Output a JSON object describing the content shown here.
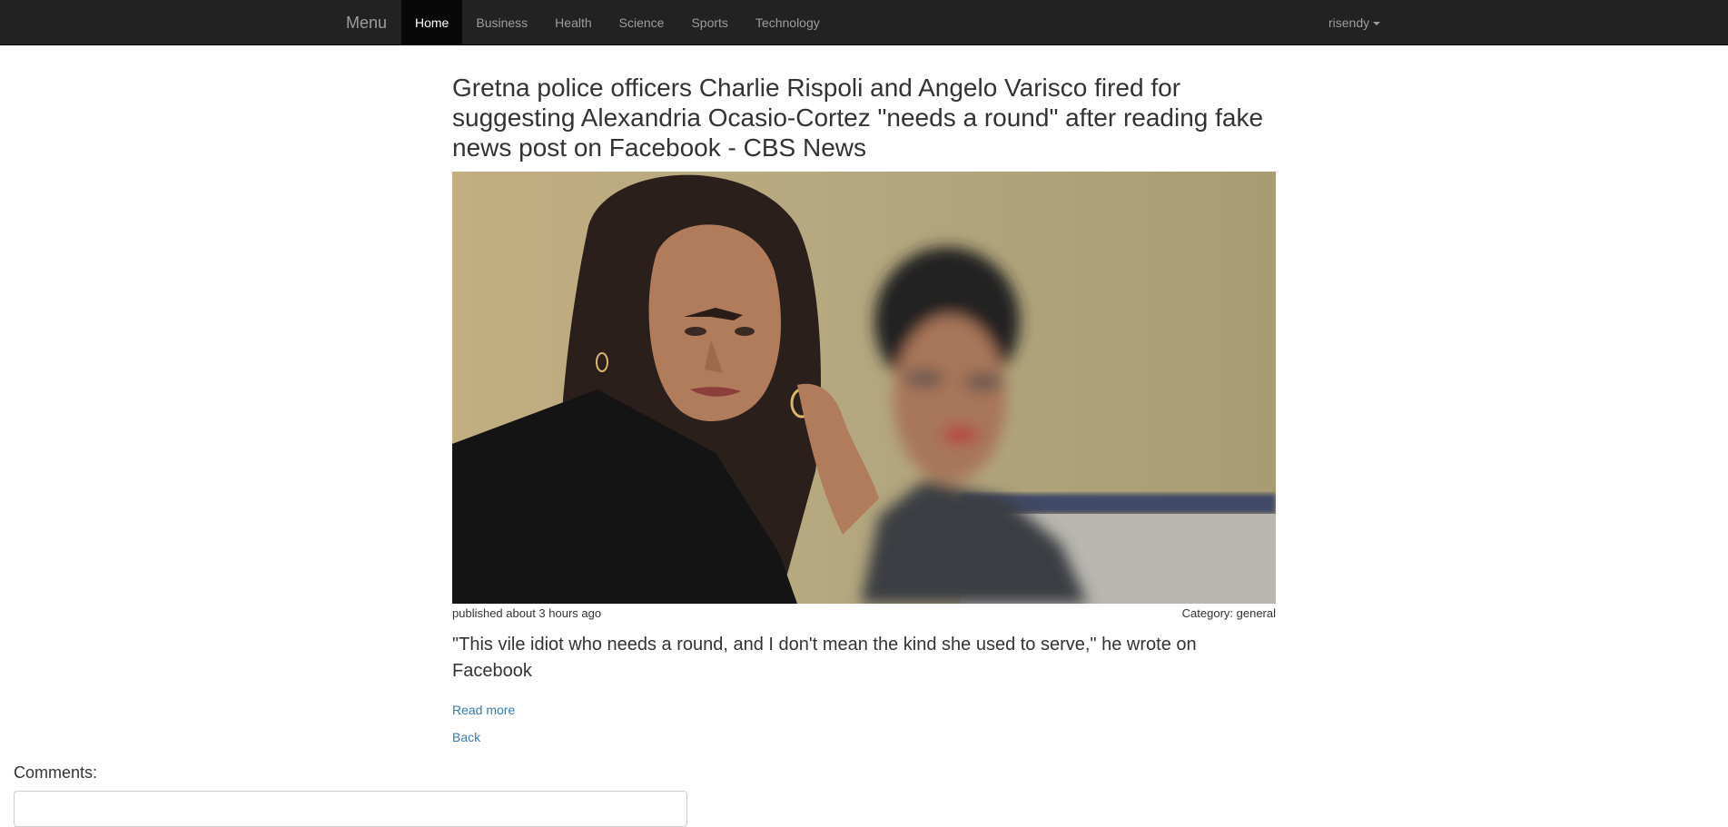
{
  "navbar": {
    "brand": "Menu",
    "items": [
      {
        "label": "Home",
        "active": true
      },
      {
        "label": "Business"
      },
      {
        "label": "Health"
      },
      {
        "label": "Science"
      },
      {
        "label": "Sports"
      },
      {
        "label": "Technology"
      }
    ],
    "user": "risendy"
  },
  "article": {
    "title": "Gretna police officers Charlie Rispoli and Angelo Varisco fired for suggesting Alexandria Ocasio-Cortez \"needs a round\" after reading fake news post on Facebook - CBS News",
    "published": "published about 3 hours ago",
    "category": "Category: general",
    "summary": "\"This vile idiot who needs a round, and I don't mean the kind she used to serve,\" he wrote on Facebook",
    "read_more": "Read more",
    "back": "Back"
  },
  "comments": {
    "label": "Comments:"
  },
  "colors": {
    "navbar_bg": "#222222",
    "link": "#337ab7",
    "text": "#333333"
  }
}
